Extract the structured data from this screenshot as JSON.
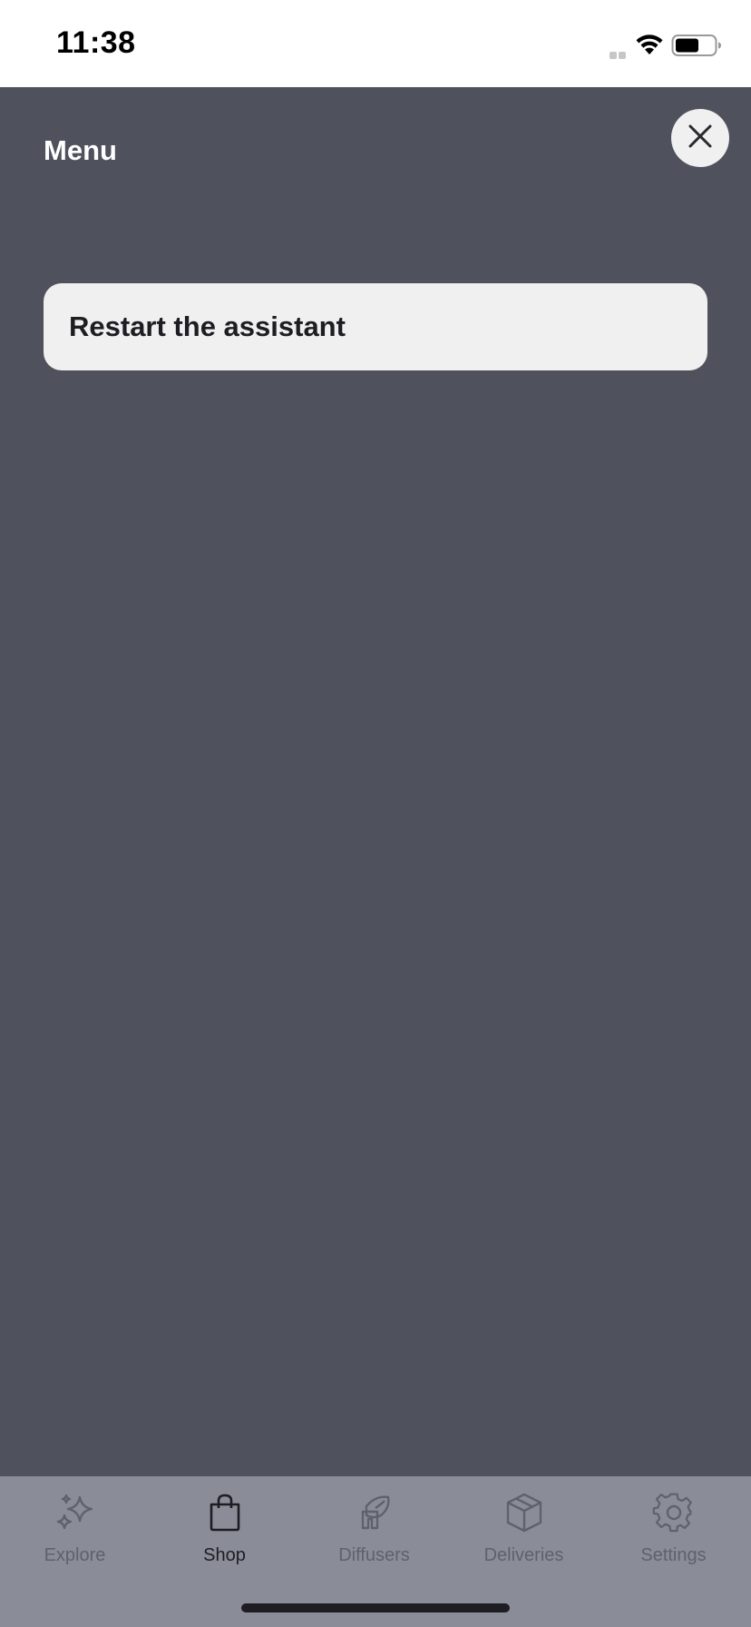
{
  "status_bar": {
    "time": "11:38"
  },
  "menu": {
    "title": "Menu",
    "close_icon": "close-icon",
    "options": [
      {
        "label": "Restart the assistant"
      }
    ]
  },
  "tab_bar": {
    "tabs": [
      {
        "label": "Explore",
        "icon": "sparkles-icon",
        "active": false
      },
      {
        "label": "Shop",
        "icon": "shopping-bag-icon",
        "active": true
      },
      {
        "label": "Diffusers",
        "icon": "diffuser-icon",
        "active": false
      },
      {
        "label": "Deliveries",
        "icon": "box-icon",
        "active": false
      },
      {
        "label": "Settings",
        "icon": "gear-icon",
        "active": false
      }
    ]
  },
  "colors": {
    "overlay": "#4f515d",
    "tab_bar": "#8a8c98",
    "button_bg": "#f0f0f0",
    "active_tab": "#1d1d22",
    "inactive_tab": "#5f616c"
  }
}
